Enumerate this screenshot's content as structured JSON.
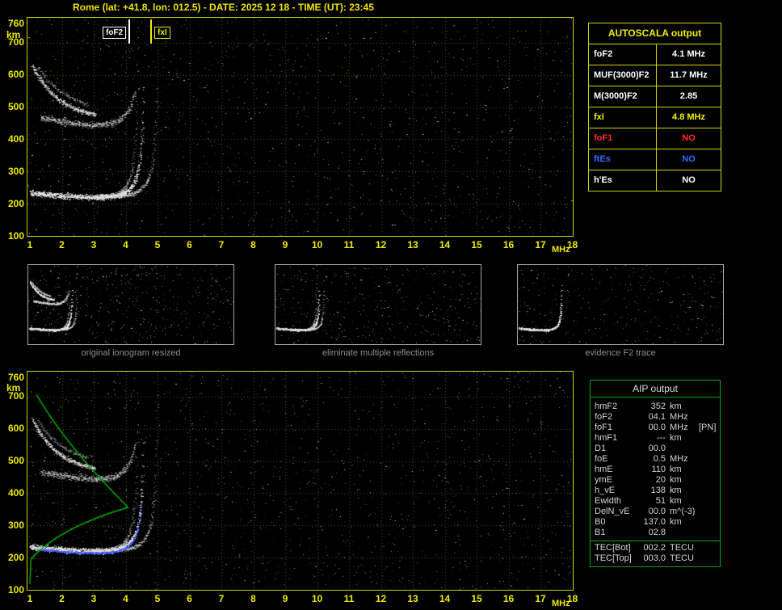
{
  "header": {
    "title": "Rome (lat: +41.8, lon: 012.5) - DATE: 2025 12 18 - TIME (UT): 23:45"
  },
  "colors": {
    "axis_yellow": "#ecec00",
    "table_border_yellow": "#d2d200",
    "aip_border_green": "#00a800",
    "profile_green": "#00b400",
    "restored_trace_blue": "#465fff"
  },
  "plot": {
    "y_unit": "km",
    "x_unit": "MHz",
    "yticks": [
      "760",
      "700",
      "600",
      "500",
      "400",
      "300",
      "200",
      "100"
    ],
    "xticks": [
      "1",
      "2",
      "3",
      "4",
      "5",
      "6",
      "7",
      "8",
      "9",
      "10",
      "11",
      "12",
      "13",
      "14",
      "15",
      "16",
      "17",
      "18"
    ],
    "y_range_km": [
      100,
      760
    ],
    "x_range_mhz": [
      1,
      18
    ]
  },
  "markers": {
    "foF2": "foF2",
    "fxI": "fxI"
  },
  "autoscala": {
    "title": "AUTOSCALA output",
    "rows": [
      {
        "label": "foF2",
        "value": "4.1 MHz",
        "color": "#ffffff"
      },
      {
        "label": "MUF(3000)F2",
        "value": "11.7 MHz",
        "color": "#ffffff"
      },
      {
        "label": "M(3000)F2",
        "value": "2.85",
        "color": "#ffffff"
      },
      {
        "label": "fxI",
        "value": "4.8 MHz",
        "color": "#f2f200"
      },
      {
        "label": "foF1",
        "value": "NO",
        "color": "#ff2a2a"
      },
      {
        "label": "ftEs",
        "value": "NO",
        "color": "#2e6bff"
      },
      {
        "label": "h'Es",
        "value": "NO",
        "color": "#ffffff"
      }
    ]
  },
  "thumbnails": [
    {
      "caption": "original ionogram resized"
    },
    {
      "caption": "eliminate multiple reflections"
    },
    {
      "caption": "evidence F2 trace"
    }
  ],
  "aip": {
    "title": "AIP output",
    "rows": [
      {
        "label": "hmF2",
        "value": "352",
        "unit": "km",
        "extra": ""
      },
      {
        "label": "foF2",
        "value": "04.1",
        "unit": "MHz",
        "extra": ""
      },
      {
        "label": "foF1",
        "value": "00.0",
        "unit": "MHz",
        "extra": "[PN]"
      },
      {
        "label": "hmF1",
        "value": "---",
        "unit": "km",
        "extra": ""
      },
      {
        "label": "D1",
        "value": "00.0",
        "unit": "",
        "extra": ""
      },
      {
        "label": "foE",
        "value": "0.5",
        "unit": "MHz",
        "extra": ""
      },
      {
        "label": "hmE",
        "value": "110",
        "unit": "km",
        "extra": ""
      },
      {
        "label": "ymE",
        "value": "20",
        "unit": "km",
        "extra": ""
      },
      {
        "label": "h_vE",
        "value": "138",
        "unit": "km",
        "extra": ""
      },
      {
        "label": "Ewidth",
        "value": "51",
        "unit": "km",
        "extra": ""
      },
      {
        "label": "DelN_vE",
        "value": "00.0",
        "unit": "m^(-3)",
        "extra": ""
      },
      {
        "label": "B0",
        "value": "137.0",
        "unit": "km",
        "extra": ""
      },
      {
        "label": "B1",
        "value": "02.8",
        "unit": "",
        "extra": ""
      }
    ],
    "tec_rows": [
      {
        "label": "TEC[Bot]",
        "value": "002.2",
        "unit": "TECU",
        "extra": ""
      },
      {
        "label": "TEC[Top]",
        "value": "003.0",
        "unit": "TECU",
        "extra": ""
      }
    ]
  }
}
